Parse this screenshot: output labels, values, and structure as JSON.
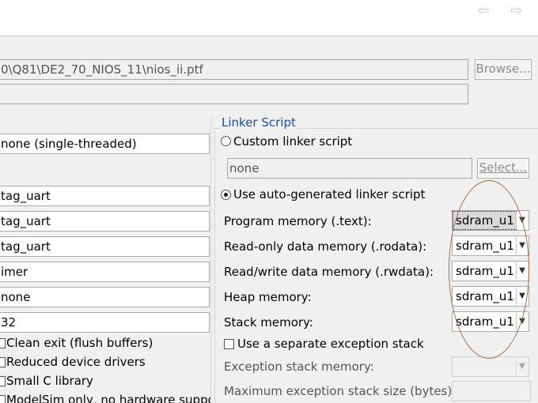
{
  "header": {
    "back_icon": "back-arrow-icon",
    "forward_icon": "forward-arrow-icon"
  },
  "ptf": {
    "path": "0\\Q81\\DE2_70_NIOS_11\\nios_ii.ptf",
    "browse_label": "Browse...",
    "second_field": ""
  },
  "left": {
    "fields": [
      "none (single-threaded)",
      "tag_uart",
      "tag_uart",
      "tag_uart",
      "imer",
      "none",
      "32"
    ],
    "checkboxes": [
      {
        "label": "Clean exit (flush buffers)",
        "checked": false
      },
      {
        "label": "Reduced device drivers",
        "checked": false
      },
      {
        "label": "Small C library",
        "checked": false
      },
      {
        "label": "ModelSim only, no hardware suppo",
        "checked": false
      }
    ]
  },
  "linker": {
    "group_title": "Linker Script",
    "custom_label": "Custom linker script",
    "custom_value": "none",
    "select_label": "Select...",
    "auto_label": "Use auto-generated linker script",
    "rows": [
      {
        "label": "Program memory (.text):",
        "value": "sdram_u1"
      },
      {
        "label": "Read-only data memory (.rodata):",
        "value": "sdram_u1"
      },
      {
        "label": "Read/write data memory (.rwdata):",
        "value": "sdram_u1"
      },
      {
        "label": "Heap memory:",
        "value": "sdram_u1"
      },
      {
        "label": "Stack memory:",
        "value": "sdram_u1"
      }
    ],
    "separate_stack_label": "Use a separate exception stack",
    "exception_stack_label": "Exception stack memory:",
    "exception_stack_value": "",
    "max_exception_label": "Maximum exception stack size (bytes):",
    "max_exception_value": ""
  },
  "colors": {
    "group_title": "#1f4fa8",
    "annotation": "#a86a3c"
  }
}
